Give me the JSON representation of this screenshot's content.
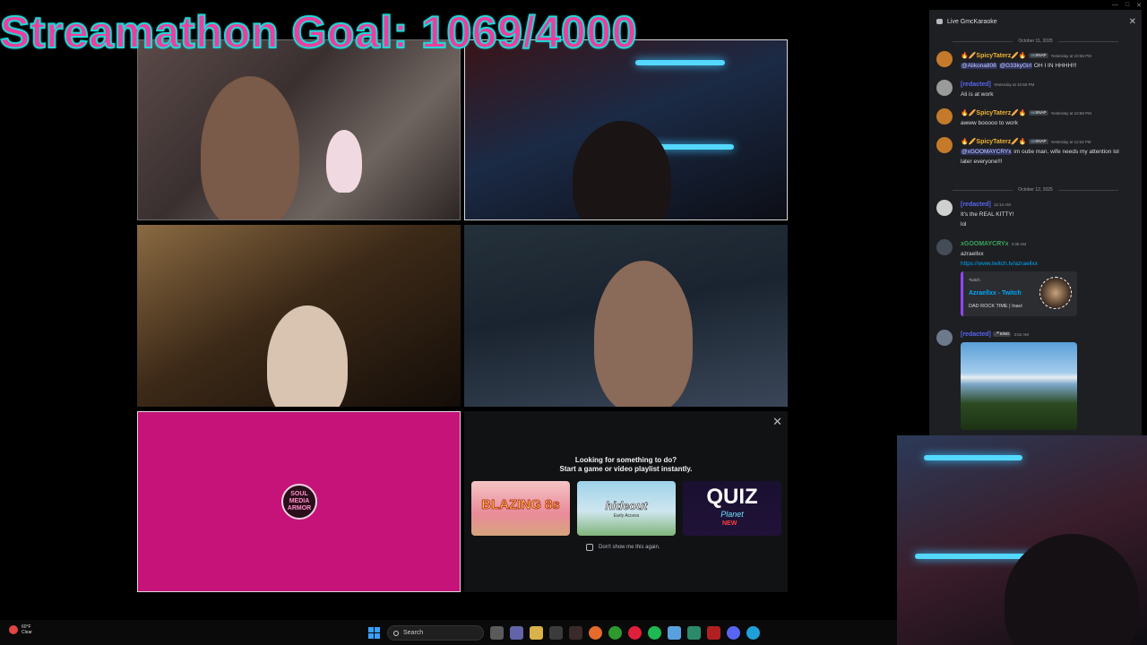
{
  "overlay": {
    "goal_text": "Streamathon Goal: 1069/4000"
  },
  "window_controls": {
    "minimize": "—",
    "maximize": "□",
    "close": "✕"
  },
  "tiles": {
    "tile5_logo": "SOUL MEDIA ARMOR"
  },
  "activity_panel": {
    "close": "✕",
    "line1": "Looking for something to do?",
    "line2": "Start a game or video playlist instantly.",
    "cards": [
      {
        "title": "BLAZING 8s"
      },
      {
        "title": "hideout",
        "sub": "Early Access"
      },
      {
        "title": "QUIZ",
        "sub": "Planet",
        "tag": "NEW"
      }
    ],
    "dont_show": "Don't show me this again."
  },
  "chat": {
    "title": "Live GmcKaraoke",
    "close": "✕",
    "divider1": "October 11, 2025",
    "divider2": "October 12, 2025",
    "messages": [
      {
        "user": "🔥🥖SpicyTaterz🥖🔥",
        "badge": "📹SNAP",
        "time": "Yesterday at 10:55 PM",
        "mentions": [
          "@Alikona808",
          "@G33kyGirl"
        ],
        "text": "OH I IN HHHH!!!",
        "color": "#f0b232",
        "avatar": "#c47a2a"
      },
      {
        "user": "[redacted]",
        "time": "Yesterday at 10:56 PM",
        "text": "Ali is at work",
        "color": "#5865f2",
        "avatar": "#9a9a9a"
      },
      {
        "user": "🔥🥖SpicyTaterz🥖🔥",
        "badge": "📹SNAP",
        "time": "Yesterday at 10:58 PM",
        "text": "awww booooo to work",
        "color": "#f0b232",
        "avatar": "#c47a2a"
      },
      {
        "user": "🔥🥖SpicyTaterz🥖🔥",
        "badge": "📹SNAP",
        "time": "Yesterday at 11:53 PM",
        "mentions": [
          "@xGOOMAYCRYx"
        ],
        "text": "im outie man. wife needs my attention lol",
        "text2": "later everyone!!!",
        "color": "#f0b232",
        "avatar": "#c47a2a"
      },
      {
        "user": "[redacted]",
        "time": "12:14 AM",
        "text": "It's the REAL KITTY!",
        "text2": "lol",
        "color": "#5865f2",
        "avatar": "#cfcfcf"
      },
      {
        "user": "xGOOMAYCRYx",
        "time": "2:36 AM",
        "text": "azraellxx",
        "link": "https://www.twitch.tv/azraellxx",
        "color": "#3ba55c",
        "avatar": "#444c58"
      },
      {
        "user": "[redacted]",
        "badge": "🎤SING",
        "time": "3:52 AM",
        "color": "#5865f2",
        "avatar": "#6c7a8c"
      }
    ],
    "embed": {
      "provider": "Twitch",
      "title": "Azraellxx - Twitch",
      "desc": "DAD ROCK TIME | Inavi"
    }
  },
  "taskbar": {
    "weather_temp": "60°F",
    "weather_cond": "Clear",
    "search_label": "Search",
    "icons": [
      "start-icon",
      "task-view-icon",
      "teams-icon",
      "explorer-icon",
      "store-icon",
      "obs-icon",
      "firefox-icon",
      "xbox-icon",
      "opera-icon",
      "spotify-icon",
      "photos-icon",
      "app-icon",
      "files-icon",
      "discord-icon",
      "edge-icon"
    ]
  },
  "colors": {
    "goal_fill": "#ee3d9b",
    "goal_stroke": "#23d6d6",
    "tile5_bg": "#c5137a",
    "chat_bg": "#1e1f22"
  }
}
